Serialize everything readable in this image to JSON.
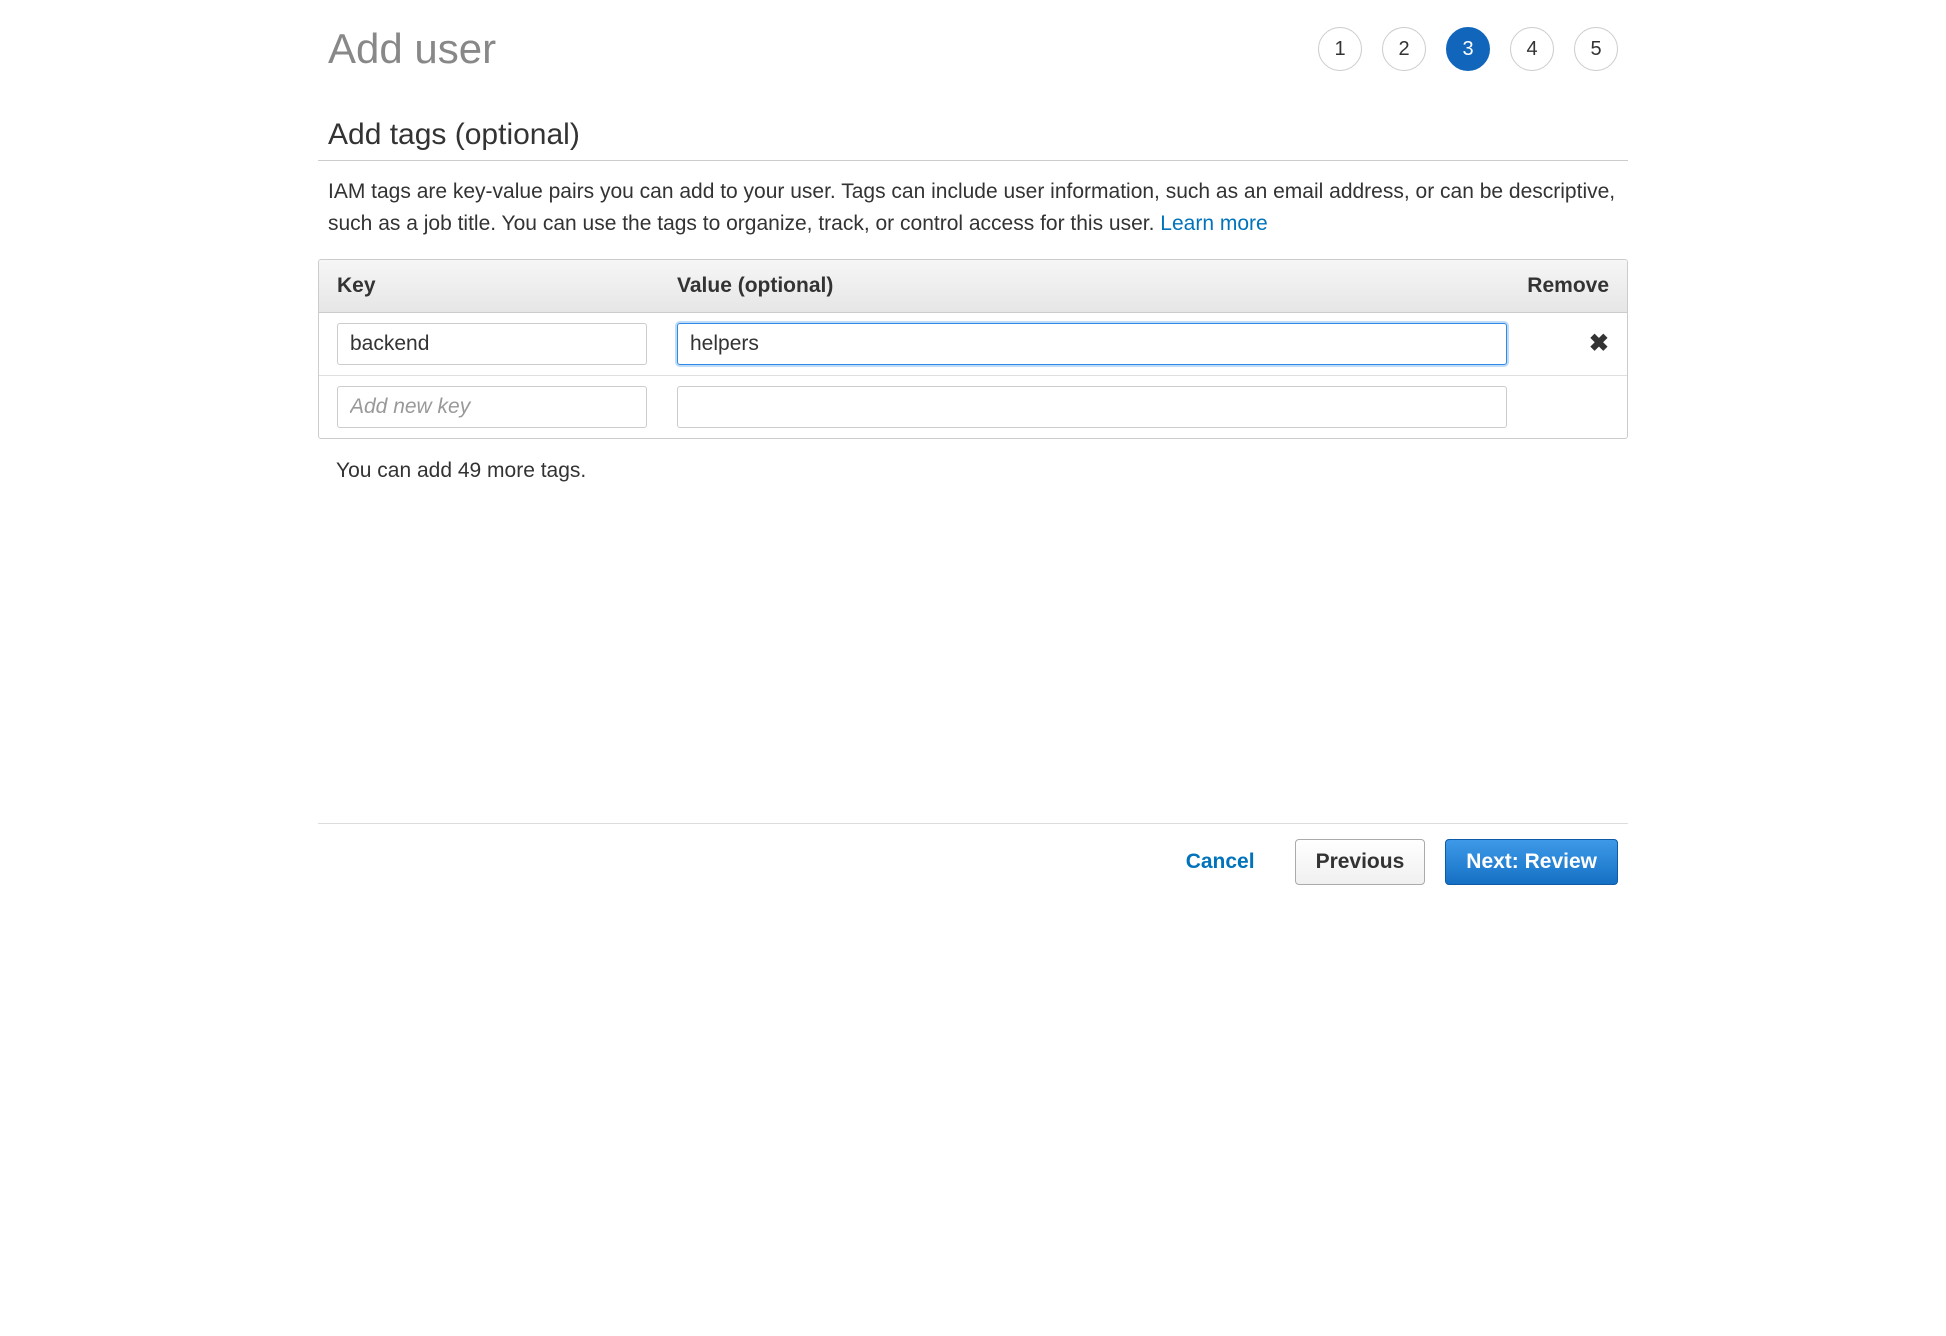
{
  "header": {
    "title": "Add user"
  },
  "stepper": {
    "steps": [
      "1",
      "2",
      "3",
      "4",
      "5"
    ],
    "active_index": 2
  },
  "section": {
    "title": "Add tags (optional)",
    "description": "IAM tags are key-value pairs you can add to your user. Tags can include user information, such as an email address, or can be descriptive, such as a job title. You can use the tags to organize, track, or control access for this user. ",
    "learn_more": "Learn more"
  },
  "table": {
    "headers": {
      "key": "Key",
      "value": "Value (optional)",
      "remove": "Remove"
    },
    "rows": [
      {
        "key": "backend",
        "value": "helpers",
        "removable": true,
        "value_focused": true
      }
    ],
    "new_row": {
      "key_placeholder": "Add new key",
      "value_placeholder": ""
    },
    "hint": "You can add 49 more tags."
  },
  "footer": {
    "cancel": "Cancel",
    "previous": "Previous",
    "next": "Next: Review"
  }
}
